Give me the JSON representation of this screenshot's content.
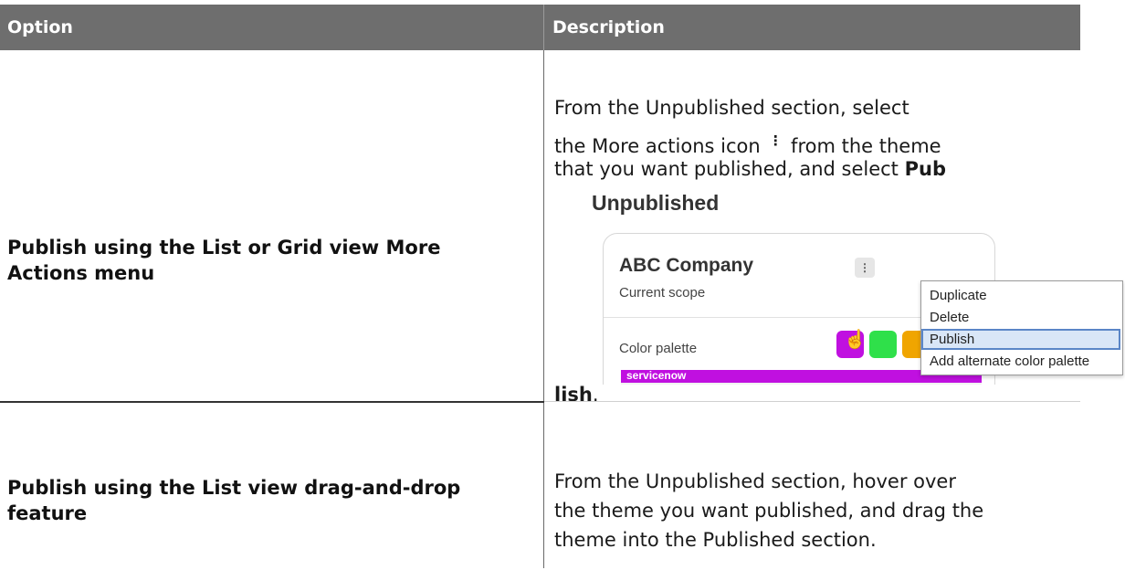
{
  "table": {
    "headers": {
      "option": "Option",
      "description": "Description"
    },
    "rows": [
      {
        "option": "Publish using the List or Grid view More Actions menu",
        "description": {
          "line1": "From the Unpublished section, select",
          "line2_pre": "the More actions icon",
          "line2_icon": "⋮",
          "line2_post": "from the theme",
          "line3_pre": "that you want published, and select",
          "line3_bold": "Pub",
          "end_bold": "lish",
          "end_tail": "."
        }
      },
      {
        "option": "Publish using the List view drag-and-drop feature",
        "description": {
          "line1": "From the Unpublished section, hover over",
          "line2": "the theme you want published, and drag the",
          "line3": "theme into the Published section."
        }
      }
    ]
  },
  "screenshot": {
    "section_heading": "Unpublished",
    "card_title": "ABC Company",
    "card_subtitle": "Current scope",
    "palette_label": "Color palette",
    "brand": "servicenow",
    "kebab_icon": "⋮",
    "swatch_colors": [
      "#c010e0",
      "#2fe04a",
      "#f0a500"
    ],
    "menu_items": [
      "Duplicate",
      "Delete",
      "Publish",
      "Add alternate color palette"
    ],
    "active_menu_item": "Publish",
    "cursor_icon": "pointer-hand-icon"
  }
}
